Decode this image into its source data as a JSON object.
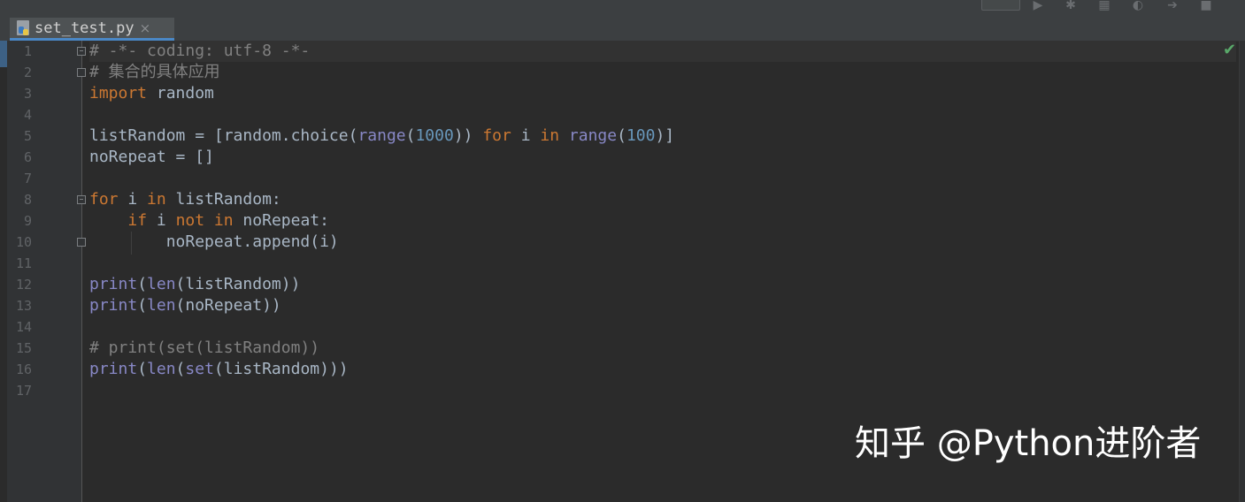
{
  "editor": {
    "tab": {
      "filename": "set_test.py",
      "close_glyph": "×",
      "icon": "python-file-icon"
    },
    "status_icon": "check-icon",
    "line_numbers": [
      "1",
      "2",
      "3",
      "4",
      "5",
      "6",
      "7",
      "8",
      "9",
      "10",
      "11",
      "12",
      "13",
      "14",
      "15",
      "16",
      "17"
    ],
    "lines": [
      [
        {
          "t": "# -*- coding: utf-8 -*-",
          "c": "cm"
        }
      ],
      [
        {
          "t": "# 集合的具体应用",
          "c": "cm"
        }
      ],
      [
        {
          "t": "import",
          "c": "kw"
        },
        {
          "t": " random",
          "c": ""
        }
      ],
      [],
      [
        {
          "t": "listRandom = [random.choice(",
          "c": ""
        },
        {
          "t": "range",
          "c": "bi"
        },
        {
          "t": "(",
          "c": ""
        },
        {
          "t": "1000",
          "c": "num"
        },
        {
          "t": ")) ",
          "c": ""
        },
        {
          "t": "for",
          "c": "kw"
        },
        {
          "t": " i ",
          "c": ""
        },
        {
          "t": "in",
          "c": "kw"
        },
        {
          "t": " ",
          "c": ""
        },
        {
          "t": "range",
          "c": "bi"
        },
        {
          "t": "(",
          "c": ""
        },
        {
          "t": "100",
          "c": "num"
        },
        {
          "t": ")]",
          "c": ""
        }
      ],
      [
        {
          "t": "noRepeat = []",
          "c": ""
        }
      ],
      [],
      [
        {
          "t": "for",
          "c": "kw"
        },
        {
          "t": " i ",
          "c": ""
        },
        {
          "t": "in",
          "c": "kw"
        },
        {
          "t": " listRandom:",
          "c": ""
        }
      ],
      [
        {
          "t": "    ",
          "c": ""
        },
        {
          "t": "if",
          "c": "kw"
        },
        {
          "t": " i ",
          "c": ""
        },
        {
          "t": "not in",
          "c": "kw"
        },
        {
          "t": " noRepeat:",
          "c": ""
        }
      ],
      [
        {
          "t": "        noRepeat.append(i)",
          "c": ""
        }
      ],
      [],
      [
        {
          "t": "print",
          "c": "bi"
        },
        {
          "t": "(",
          "c": ""
        },
        {
          "t": "len",
          "c": "bi"
        },
        {
          "t": "(listRandom))",
          "c": ""
        }
      ],
      [
        {
          "t": "print",
          "c": "bi"
        },
        {
          "t": "(",
          "c": ""
        },
        {
          "t": "len",
          "c": "bi"
        },
        {
          "t": "(noRepeat))",
          "c": ""
        }
      ],
      [],
      [
        {
          "t": "# print(set(listRandom))",
          "c": "cm"
        }
      ],
      [
        {
          "t": "print",
          "c": "bi"
        },
        {
          "t": "(",
          "c": ""
        },
        {
          "t": "len",
          "c": "bi"
        },
        {
          "t": "(",
          "c": ""
        },
        {
          "t": "set",
          "c": "bi"
        },
        {
          "t": "(listRandom)))",
          "c": ""
        }
      ],
      []
    ]
  },
  "watermark": {
    "text": "知乎 @Python进阶者"
  },
  "colors": {
    "background": "#2b2b2b",
    "gutter": "#313335",
    "keyword": "#cc7832",
    "builtin": "#8888c6",
    "number": "#6897bb",
    "comment": "#808080",
    "text": "#a9b7c6",
    "ok": "#59a869"
  }
}
